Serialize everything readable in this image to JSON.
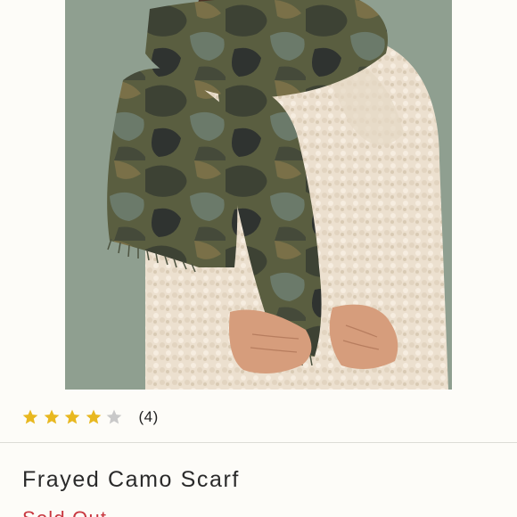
{
  "product": {
    "image_alt": "",
    "name": "Frayed Camo Scarf",
    "status": "Sold Out",
    "status_color": "#c8373f"
  },
  "rating": {
    "value": 4,
    "max": 5,
    "count_label": "(4)",
    "star_filled_color": "#e8b820",
    "star_empty_color": "#c9c9c9"
  }
}
